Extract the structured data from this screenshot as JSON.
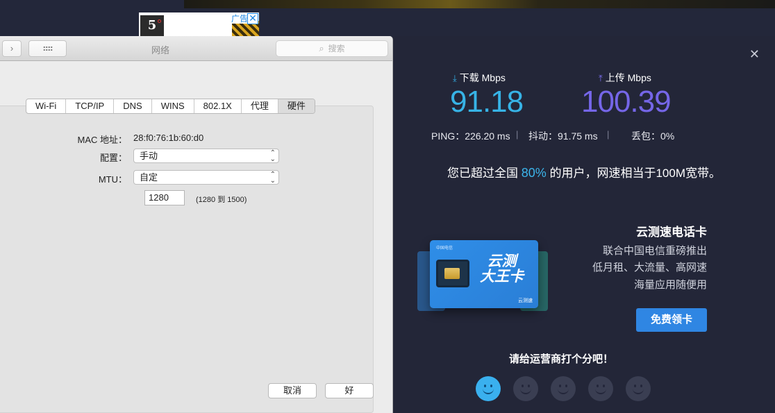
{
  "ad": {
    "thumb_text": "5",
    "label": "广告",
    "close": "✕"
  },
  "mac_window": {
    "title": "网络",
    "search_placeholder": "搜索",
    "forward_label": "›",
    "tabs": [
      "Wi-Fi",
      "TCP/IP",
      "DNS",
      "WINS",
      "802.1X",
      "代理",
      "硬件"
    ],
    "active_tab": "硬件",
    "mac_address_label": "MAC 地址：",
    "mac_address_value": "28:f0:76:1b:60:d0",
    "config_label": "配置：",
    "config_value": "手动",
    "mtu_label": "MTU：",
    "mtu_value": "自定",
    "mtu_number": "1280",
    "mtu_range": "(1280 到 1500)",
    "cancel_label": "取消",
    "ok_label": "好"
  },
  "speedtest": {
    "close": "✕",
    "download_label": "下载 Mbps",
    "download_value": "91.18",
    "upload_label": "上传 Mbps",
    "upload_value": "100.39",
    "ping_text": "PING：226.20 ms",
    "jitter_text": "抖动：91.75 ms",
    "loss_text": "丢包：0%",
    "summary_before": "您已超过全国 ",
    "summary_pct": "80%",
    "summary_after": " 的用户，网速相当于100M宽带。",
    "colors": {
      "download": "#37b3e6",
      "upload": "#7566e8",
      "accent": "#2f86e3"
    },
    "promo": {
      "title": "云测速电话卡",
      "lines": [
        "联合中国电信重磅推出",
        "低月租、大流量、高网速",
        "海量应用随便用"
      ],
      "button": "免费领卡",
      "card_title_line1": "云测",
      "card_title_line2": "大王卡",
      "card_logo": "中国电信",
      "card_brand": "云测速"
    },
    "rate_prompt": "请给运营商打个分吧！",
    "rating_faces": 5,
    "rating_selected": 1
  }
}
